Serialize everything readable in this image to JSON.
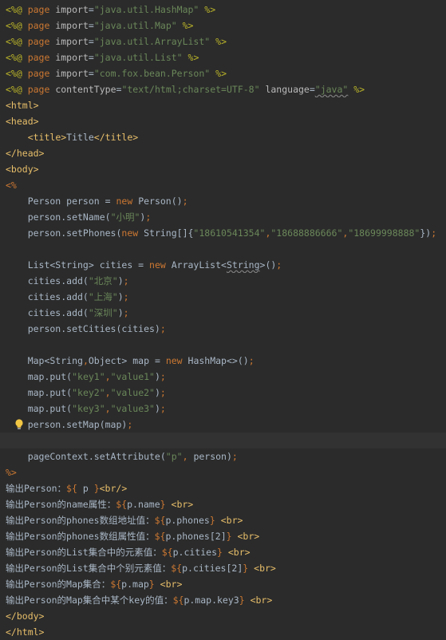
{
  "lines": [
    {
      "segs": [
        {
          "c": "c-dir",
          "t": "<%@ "
        },
        {
          "c": "c-kw",
          "t": "page "
        },
        {
          "c": "c-attr",
          "t": "import"
        },
        {
          "c": "c-plain",
          "t": "="
        },
        {
          "c": "c-str",
          "t": "\"java.util.HashMap\""
        },
        {
          "c": "c-dir",
          "t": " %>"
        }
      ]
    },
    {
      "segs": [
        {
          "c": "c-dir",
          "t": "<%@ "
        },
        {
          "c": "c-kw",
          "t": "page "
        },
        {
          "c": "c-attr",
          "t": "import"
        },
        {
          "c": "c-plain",
          "t": "="
        },
        {
          "c": "c-str",
          "t": "\"java.util.Map\""
        },
        {
          "c": "c-dir",
          "t": " %>"
        }
      ]
    },
    {
      "segs": [
        {
          "c": "c-dir",
          "t": "<%@ "
        },
        {
          "c": "c-kw",
          "t": "page "
        },
        {
          "c": "c-attr",
          "t": "import"
        },
        {
          "c": "c-plain",
          "t": "="
        },
        {
          "c": "c-str",
          "t": "\"java.util.ArrayList\""
        },
        {
          "c": "c-dir",
          "t": " %>"
        }
      ]
    },
    {
      "segs": [
        {
          "c": "c-dir",
          "t": "<%@ "
        },
        {
          "c": "c-kw",
          "t": "page "
        },
        {
          "c": "c-attr",
          "t": "import"
        },
        {
          "c": "c-plain",
          "t": "="
        },
        {
          "c": "c-str",
          "t": "\"java.util.List\""
        },
        {
          "c": "c-dir",
          "t": " %>"
        }
      ]
    },
    {
      "segs": [
        {
          "c": "c-dir",
          "t": "<%@ "
        },
        {
          "c": "c-kw",
          "t": "page "
        },
        {
          "c": "c-attr",
          "t": "import"
        },
        {
          "c": "c-plain",
          "t": "="
        },
        {
          "c": "c-str",
          "t": "\"com.fox.bean.Person\""
        },
        {
          "c": "c-dir",
          "t": " %>"
        }
      ]
    },
    {
      "segs": [
        {
          "c": "c-dir",
          "t": "<%@ "
        },
        {
          "c": "c-kw",
          "t": "page "
        },
        {
          "c": "c-attr",
          "t": "contentType"
        },
        {
          "c": "c-plain",
          "t": "="
        },
        {
          "c": "c-str",
          "t": "\"text/html;charset=UTF-8\""
        },
        {
          "c": "c-attr",
          "t": " language"
        },
        {
          "c": "c-plain",
          "t": "="
        },
        {
          "c": "c-str squiggle",
          "t": "\"java\""
        },
        {
          "c": "c-dir",
          "t": " %>"
        }
      ]
    },
    {
      "segs": [
        {
          "c": "c-tag",
          "t": "<html>"
        }
      ]
    },
    {
      "segs": [
        {
          "c": "c-tag",
          "t": "<head>"
        }
      ]
    },
    {
      "segs": [
        {
          "c": "c-plain",
          "t": "    "
        },
        {
          "c": "c-tag",
          "t": "<title>"
        },
        {
          "c": "c-plain",
          "t": "Title"
        },
        {
          "c": "c-tag",
          "t": "</title>"
        }
      ]
    },
    {
      "segs": [
        {
          "c": "c-tag",
          "t": "</head>"
        }
      ]
    },
    {
      "segs": [
        {
          "c": "c-tag",
          "t": "<body>"
        }
      ]
    },
    {
      "segs": [
        {
          "c": "c-kw",
          "t": "<%"
        }
      ]
    },
    {
      "segs": [
        {
          "c": "c-plain",
          "t": "    Person person = "
        },
        {
          "c": "c-kw",
          "t": "new "
        },
        {
          "c": "c-plain",
          "t": "Person()"
        },
        {
          "c": "c-kw",
          "t": ";"
        }
      ]
    },
    {
      "segs": [
        {
          "c": "c-plain",
          "t": "    person.setName("
        },
        {
          "c": "c-str",
          "t": "\"小明\""
        },
        {
          "c": "c-plain",
          "t": ")"
        },
        {
          "c": "c-kw",
          "t": ";"
        }
      ]
    },
    {
      "segs": [
        {
          "c": "c-plain",
          "t": "    person.setPhones("
        },
        {
          "c": "c-kw",
          "t": "new "
        },
        {
          "c": "c-plain",
          "t": "String[]{"
        },
        {
          "c": "c-str",
          "t": "\"18610541354\""
        },
        {
          "c": "c-kw",
          "t": ","
        },
        {
          "c": "c-str",
          "t": "\"18688886666\""
        },
        {
          "c": "c-kw",
          "t": ","
        },
        {
          "c": "c-str",
          "t": "\"18699998888\""
        },
        {
          "c": "c-plain",
          "t": "})"
        },
        {
          "c": "c-kw",
          "t": ";"
        }
      ]
    },
    {
      "segs": [
        {
          "c": "c-plain",
          "t": ""
        }
      ]
    },
    {
      "segs": [
        {
          "c": "c-plain",
          "t": "    List<String> cities = "
        },
        {
          "c": "c-kw",
          "t": "new "
        },
        {
          "c": "c-plain",
          "t": "ArrayList<"
        },
        {
          "c": "c-plain squiggle",
          "t": "String"
        },
        {
          "c": "c-plain",
          "t": ">()"
        },
        {
          "c": "c-kw",
          "t": ";"
        }
      ]
    },
    {
      "segs": [
        {
          "c": "c-plain",
          "t": "    cities.add("
        },
        {
          "c": "c-str",
          "t": "\"北京\""
        },
        {
          "c": "c-plain",
          "t": ")"
        },
        {
          "c": "c-kw",
          "t": ";"
        }
      ]
    },
    {
      "segs": [
        {
          "c": "c-plain",
          "t": "    cities.add("
        },
        {
          "c": "c-str",
          "t": "\"上海\""
        },
        {
          "c": "c-plain",
          "t": ")"
        },
        {
          "c": "c-kw",
          "t": ";"
        }
      ]
    },
    {
      "segs": [
        {
          "c": "c-plain",
          "t": "    cities.add("
        },
        {
          "c": "c-str",
          "t": "\"深圳\""
        },
        {
          "c": "c-plain",
          "t": ")"
        },
        {
          "c": "c-kw",
          "t": ";"
        }
      ]
    },
    {
      "segs": [
        {
          "c": "c-plain",
          "t": "    person.setCities(cities)"
        },
        {
          "c": "c-kw",
          "t": ";"
        }
      ]
    },
    {
      "segs": [
        {
          "c": "c-plain",
          "t": ""
        }
      ]
    },
    {
      "segs": [
        {
          "c": "c-plain",
          "t": "    Map<String"
        },
        {
          "c": "c-kw",
          "t": ","
        },
        {
          "c": "c-plain",
          "t": "Object> map = "
        },
        {
          "c": "c-kw",
          "t": "new "
        },
        {
          "c": "c-plain",
          "t": "HashMap<>()"
        },
        {
          "c": "c-kw",
          "t": ";"
        }
      ]
    },
    {
      "segs": [
        {
          "c": "c-plain",
          "t": "    map.put("
        },
        {
          "c": "c-str",
          "t": "\"key1\""
        },
        {
          "c": "c-kw",
          "t": ","
        },
        {
          "c": "c-str",
          "t": "\"value1\""
        },
        {
          "c": "c-plain",
          "t": ")"
        },
        {
          "c": "c-kw",
          "t": ";"
        }
      ]
    },
    {
      "segs": [
        {
          "c": "c-plain",
          "t": "    map.put("
        },
        {
          "c": "c-str",
          "t": "\"key2\""
        },
        {
          "c": "c-kw",
          "t": ","
        },
        {
          "c": "c-str",
          "t": "\"value2\""
        },
        {
          "c": "c-plain",
          "t": ")"
        },
        {
          "c": "c-kw",
          "t": ";"
        }
      ]
    },
    {
      "segs": [
        {
          "c": "c-plain",
          "t": "    map.put("
        },
        {
          "c": "c-str",
          "t": "\"key3\""
        },
        {
          "c": "c-kw",
          "t": ","
        },
        {
          "c": "c-str",
          "t": "\"value3\""
        },
        {
          "c": "c-plain",
          "t": ")"
        },
        {
          "c": "c-kw",
          "t": ";"
        }
      ]
    },
    {
      "segs": [
        {
          "c": "c-plain",
          "t": "    person.setMap(map)"
        },
        {
          "c": "c-kw",
          "t": ";"
        }
      ],
      "bulb": true
    },
    {
      "segs": [
        {
          "c": "c-plain",
          "t": ""
        }
      ],
      "current": true
    },
    {
      "segs": [
        {
          "c": "c-plain",
          "t": "    pageContext.setAttribute("
        },
        {
          "c": "c-str",
          "t": "\"p\""
        },
        {
          "c": "c-kw",
          "t": ", "
        },
        {
          "c": "c-plain",
          "t": "person)"
        },
        {
          "c": "c-kw",
          "t": ";"
        }
      ]
    },
    {
      "segs": [
        {
          "c": "c-kw",
          "t": "%>"
        }
      ]
    },
    {
      "segs": [
        {
          "c": "c-text",
          "t": "输出Person："
        },
        {
          "c": "c-brace",
          "t": "${"
        },
        {
          "c": "c-plain",
          "t": " p "
        },
        {
          "c": "c-brace",
          "t": "}"
        },
        {
          "c": "c-tag",
          "t": "<br/>"
        }
      ]
    },
    {
      "segs": [
        {
          "c": "c-text",
          "t": "输出Person的name属性："
        },
        {
          "c": "c-brace",
          "t": "${"
        },
        {
          "c": "c-plain",
          "t": "p.name"
        },
        {
          "c": "c-brace",
          "t": "}"
        },
        {
          "c": "c-text",
          "t": " "
        },
        {
          "c": "c-tag",
          "t": "<br>"
        }
      ]
    },
    {
      "segs": [
        {
          "c": "c-text",
          "t": "输出Person的phones数组地址值："
        },
        {
          "c": "c-brace",
          "t": "${"
        },
        {
          "c": "c-plain",
          "t": "p.phones"
        },
        {
          "c": "c-brace",
          "t": "}"
        },
        {
          "c": "c-text",
          "t": " "
        },
        {
          "c": "c-tag",
          "t": "<br>"
        }
      ]
    },
    {
      "segs": [
        {
          "c": "c-text",
          "t": "输出Person的phones数组属性值："
        },
        {
          "c": "c-brace",
          "t": "${"
        },
        {
          "c": "c-plain",
          "t": "p.phones[2]"
        },
        {
          "c": "c-brace",
          "t": "}"
        },
        {
          "c": "c-text",
          "t": " "
        },
        {
          "c": "c-tag",
          "t": "<br>"
        }
      ]
    },
    {
      "segs": [
        {
          "c": "c-text",
          "t": "输出Person的List集合中的元素值："
        },
        {
          "c": "c-brace",
          "t": "${"
        },
        {
          "c": "c-plain",
          "t": "p.cities"
        },
        {
          "c": "c-brace",
          "t": "}"
        },
        {
          "c": "c-text",
          "t": " "
        },
        {
          "c": "c-tag",
          "t": "<br>"
        }
      ]
    },
    {
      "segs": [
        {
          "c": "c-text",
          "t": "输出Person的List集合中个别元素值："
        },
        {
          "c": "c-brace",
          "t": "${"
        },
        {
          "c": "c-plain",
          "t": "p.cities[2]"
        },
        {
          "c": "c-brace",
          "t": "}"
        },
        {
          "c": "c-text",
          "t": " "
        },
        {
          "c": "c-tag",
          "t": "<br>"
        }
      ]
    },
    {
      "segs": [
        {
          "c": "c-text",
          "t": "输出Person的Map集合："
        },
        {
          "c": "c-brace",
          "t": "${"
        },
        {
          "c": "c-plain",
          "t": "p.map"
        },
        {
          "c": "c-brace",
          "t": "}"
        },
        {
          "c": "c-text",
          "t": " "
        },
        {
          "c": "c-tag",
          "t": "<br>"
        }
      ]
    },
    {
      "segs": [
        {
          "c": "c-text",
          "t": "输出Person的Map集合中某个key的值："
        },
        {
          "c": "c-brace",
          "t": "${"
        },
        {
          "c": "c-plain",
          "t": "p.map.key3"
        },
        {
          "c": "c-brace",
          "t": "}"
        },
        {
          "c": "c-text",
          "t": " "
        },
        {
          "c": "c-tag",
          "t": "<br>"
        }
      ]
    },
    {
      "segs": [
        {
          "c": "c-tag",
          "t": "</body>"
        }
      ]
    },
    {
      "segs": [
        {
          "c": "c-tag",
          "t": "</html>"
        }
      ]
    }
  ],
  "icons": {
    "bulb": "lightbulb-icon"
  },
  "colors": {
    "background": "#2b2b2b",
    "current_line": "#323232",
    "keyword": "#cc7832",
    "string": "#6a8759",
    "tag": "#e8bf6a",
    "directive": "#bbb529",
    "text": "#a9b7c6",
    "bulb": "#f2c744"
  }
}
